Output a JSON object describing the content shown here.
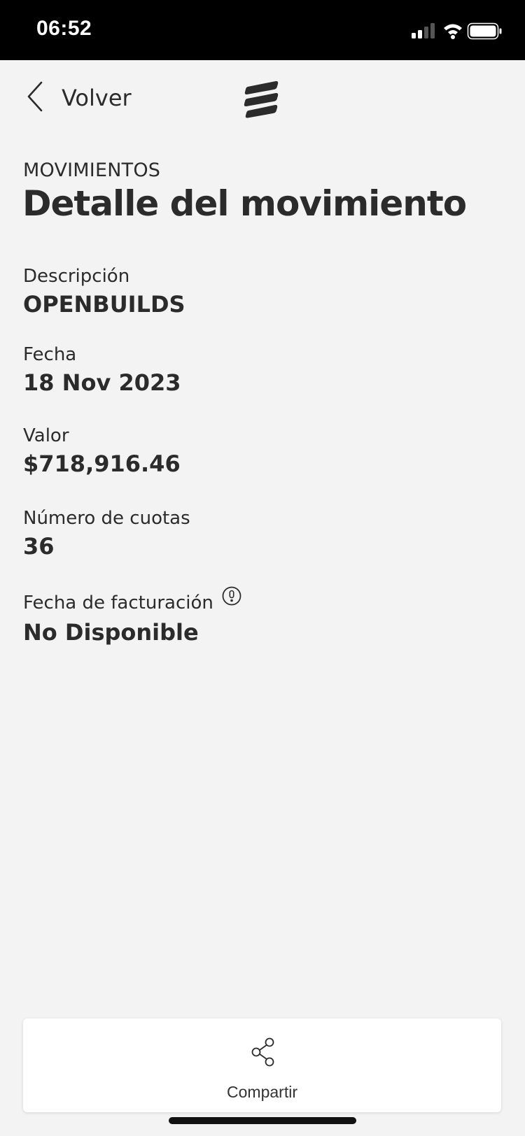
{
  "status_bar": {
    "time": "06:52",
    "signal_icon": "cellular-signal-icon",
    "wifi_icon": "wifi-icon",
    "battery_icon": "battery-icon"
  },
  "nav": {
    "back_label": "Volver",
    "back_icon": "chevron-left-icon",
    "logo_icon": "bank-logo-icon"
  },
  "header": {
    "section": "MOVIMIENTOS",
    "title": "Detalle del movimiento"
  },
  "fields": [
    {
      "label": "Descripción",
      "value": "OPENBUILDS"
    },
    {
      "label": "Fecha",
      "value": "18 Nov 2023"
    },
    {
      "label": "Valor",
      "value": "$718,916.46"
    },
    {
      "label": "Número de cuotas",
      "value": "36"
    },
    {
      "label": "Fecha de facturación",
      "value": "No Disponible",
      "info_icon": "exclamation-circle-icon"
    }
  ],
  "share": {
    "label": "Compartir",
    "icon": "share-icon"
  },
  "colors": {
    "background": "#f3f3f3",
    "text": "#2b2b2b",
    "status_bar": "#000000",
    "card": "#ffffff"
  }
}
